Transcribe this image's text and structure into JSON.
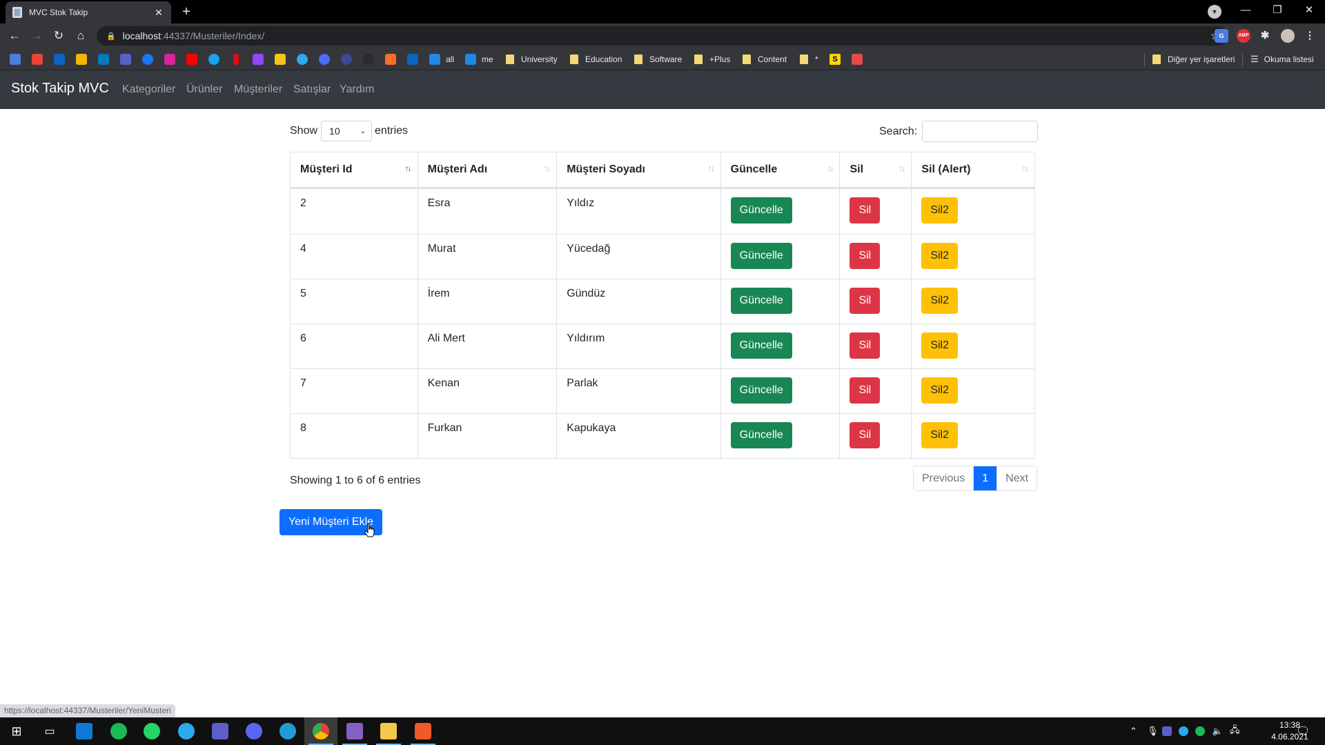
{
  "browser": {
    "tab_title": "MVC Stok Takip",
    "url_host": "localhost",
    "url_path": ":44337/Musteriler/Index/",
    "status_url": "https://localhost:44337/Musteriler/YeniMusteri",
    "bookmarks": [
      {
        "label": "all"
      },
      {
        "label": "me"
      },
      {
        "label": "University"
      },
      {
        "label": "Education"
      },
      {
        "label": "Software"
      },
      {
        "label": "+Plus"
      },
      {
        "label": "Content"
      },
      {
        "label": "*"
      }
    ],
    "other_bookmarks": "Diğer yer işaretleri",
    "reading_list": "Okuma listesi"
  },
  "navbar": {
    "brand": "Stok Takip MVC",
    "links": [
      "Kategoriler",
      "Ürünler",
      "Müşteriler",
      "Satışlar",
      "Yardım"
    ]
  },
  "datatable": {
    "show_label": "Show",
    "entries_label": "entries",
    "page_length": "10",
    "search_label": "Search:",
    "search_value": "",
    "columns": [
      "Müşteri Id",
      "Müşteri Adı",
      "Müşteri Soyadı",
      "Güncelle",
      "Sil",
      "Sil (Alert)"
    ],
    "rows": [
      {
        "id": "2",
        "ad": "Esra",
        "soyad": "Yıldız",
        "update": "Güncelle",
        "delete": "Sil",
        "delete_alert": "Sil2"
      },
      {
        "id": "4",
        "ad": "Murat",
        "soyad": "Yücedağ",
        "update": "Güncelle",
        "delete": "Sil",
        "delete_alert": "Sil2"
      },
      {
        "id": "5",
        "ad": "İrem",
        "soyad": "Gündüz",
        "update": "Güncelle",
        "delete": "Sil",
        "delete_alert": "Sil2"
      },
      {
        "id": "6",
        "ad": "Ali Mert",
        "soyad": "Yıldırım",
        "update": "Güncelle",
        "delete": "Sil",
        "delete_alert": "Sil2"
      },
      {
        "id": "7",
        "ad": "Kenan",
        "soyad": "Parlak",
        "update": "Güncelle",
        "delete": "Sil",
        "delete_alert": "Sil2"
      },
      {
        "id": "8",
        "ad": "Furkan",
        "soyad": "Kapukaya",
        "update": "Güncelle",
        "delete": "Sil",
        "delete_alert": "Sil2"
      }
    ],
    "info": "Showing 1 to 6 of 6 entries",
    "pagination": {
      "previous": "Previous",
      "current": "1",
      "next": "Next"
    }
  },
  "add_button": "Yeni Müşteri Ekle",
  "colors": {
    "navbar_bg": "#343a40",
    "success": "#198754",
    "danger": "#dc3545",
    "warning": "#ffc107",
    "primary": "#0d6efd"
  },
  "taskbar": {
    "time": "13:38",
    "date": "4.06.2021"
  }
}
